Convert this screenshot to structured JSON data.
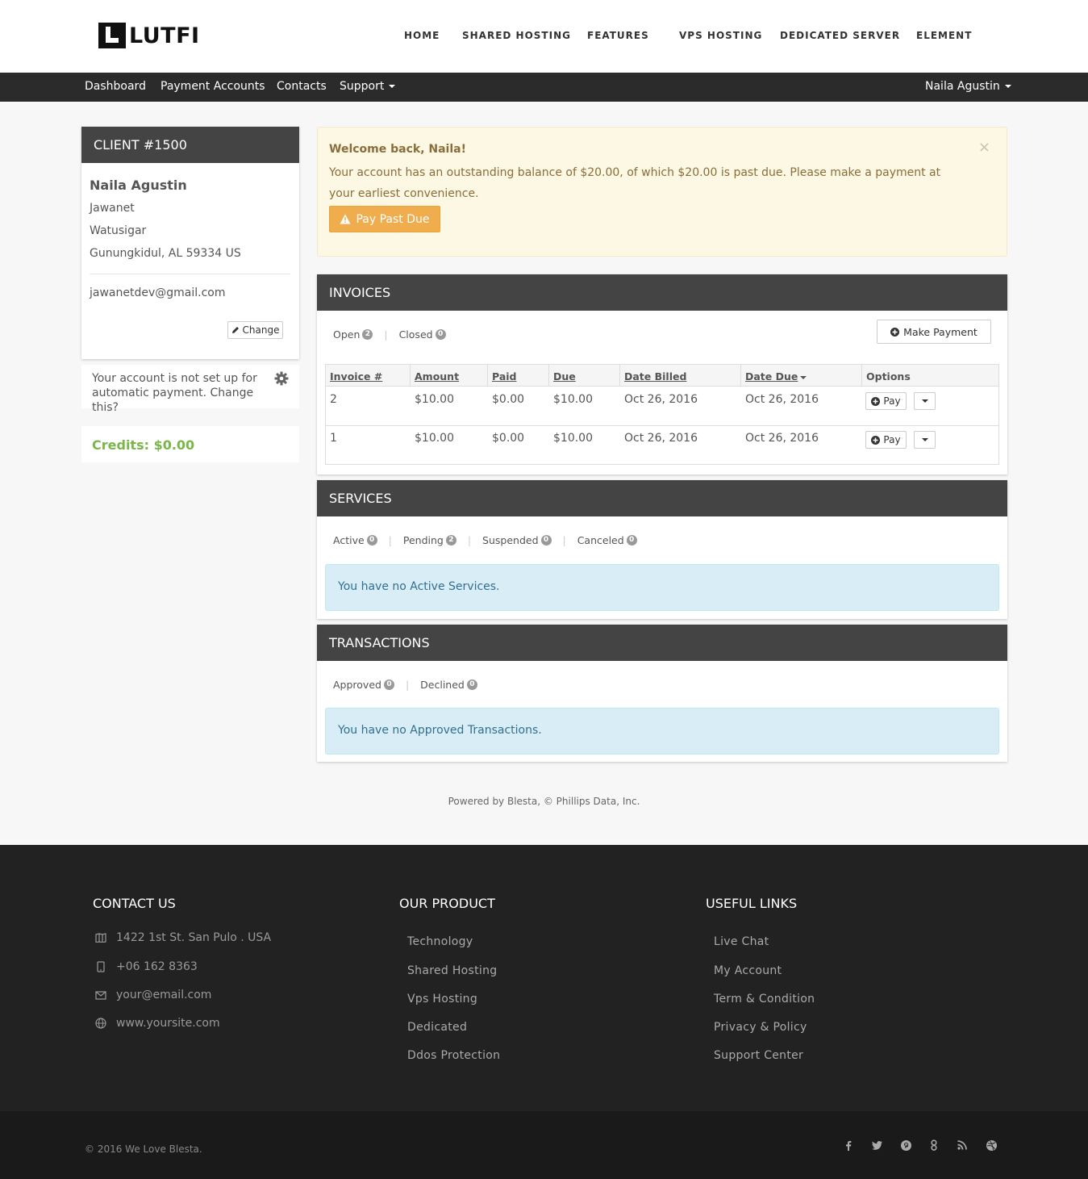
{
  "brand": {
    "logo_text": "LUTFI"
  },
  "main_nav": [
    "HOME",
    "SHARED HOSTING",
    "FEATURES",
    "VPS HOSTING",
    "DEDICATED SERVER",
    "ELEMENT"
  ],
  "sub_nav": {
    "items": [
      "Dashboard",
      "Payment Accounts",
      "Contacts",
      "Support"
    ],
    "user": "Naila Agustin"
  },
  "client": {
    "heading": "CLIENT #1500",
    "name": "Naila Agustin",
    "company": "Jawanet",
    "address1": "Watusigar",
    "address2": "Gunungkidul, AL 59334 US",
    "email": "jawanetdev@gmail.com",
    "change_label": "Change",
    "autopay_text": "Your account is not set up for automatic payment. Change this?",
    "credits": "Credits: $0.00"
  },
  "alert": {
    "title": "Welcome back, Naila!",
    "message": "Your account has an outstanding balance of $20.00, of which $20.00 is past due. Please make a payment at your earliest convenience.",
    "close": "×",
    "button": "Pay Past Due"
  },
  "invoices": {
    "heading": "INVOICES",
    "tabs": [
      {
        "label": "Open",
        "count": "2"
      },
      {
        "label": "Closed",
        "count": "0"
      }
    ],
    "make_payment": "Make Payment",
    "columns": [
      "Invoice #",
      "Amount",
      "Paid",
      "Due",
      "Date Billed",
      "Date Due",
      "Options"
    ],
    "rows": [
      {
        "invoice": "2",
        "amount": "$10.00",
        "paid": "$0.00",
        "due": "$10.00",
        "billed": "Oct 26, 2016",
        "date_due": "Oct 26, 2016",
        "pay": "Pay"
      },
      {
        "invoice": "1",
        "amount": "$10.00",
        "paid": "$0.00",
        "due": "$10.00",
        "billed": "Oct 26, 2016",
        "date_due": "Oct 26, 2016",
        "pay": "Pay"
      }
    ]
  },
  "services": {
    "heading": "SERVICES",
    "tabs": [
      {
        "label": "Active",
        "count": "0"
      },
      {
        "label": "Pending",
        "count": "2"
      },
      {
        "label": "Suspended",
        "count": "0"
      },
      {
        "label": "Canceled",
        "count": "0"
      }
    ],
    "empty": "You have no Active Services."
  },
  "transactions": {
    "heading": "TRANSACTIONS",
    "tabs": [
      {
        "label": "Approved",
        "count": "0"
      },
      {
        "label": "Declined",
        "count": "0"
      }
    ],
    "empty": "You have no Approved Transactions."
  },
  "powered_by": "Powered by Blesta, © Phillips Data, Inc.",
  "footer": {
    "contact_title": "CONTACT US",
    "contact": [
      {
        "icon": "map-icon",
        "text": "1422 1st St. San Pulo . USA"
      },
      {
        "icon": "phone-icon",
        "text": "+06 162 8363"
      },
      {
        "icon": "envelope-icon",
        "text": "your@email.com"
      },
      {
        "icon": "globe-icon",
        "text": "www.yoursite.com"
      }
    ],
    "product_title": "OUR PRODUCT",
    "products": [
      "Technology",
      "Shared Hosting",
      "Vps Hosting",
      "Dedicated",
      "Ddos Protection"
    ],
    "links_title": "USEFUL LINKS",
    "links": [
      "Live Chat",
      "My Account",
      "Term & Condition",
      "Privacy & Policy",
      "Support Center"
    ],
    "copyright": "© 2016 We Love Blesta.",
    "social": [
      "facebook-icon",
      "twitter-icon",
      "pinterest-icon",
      "google-plus-icon",
      "rss-icon",
      "dribbble-icon"
    ]
  },
  "colors": {
    "accent_warning": "#f0ad4e",
    "credits_green": "#7ab648",
    "panel_header": "#444444",
    "info_bg": "#d9edf7"
  }
}
